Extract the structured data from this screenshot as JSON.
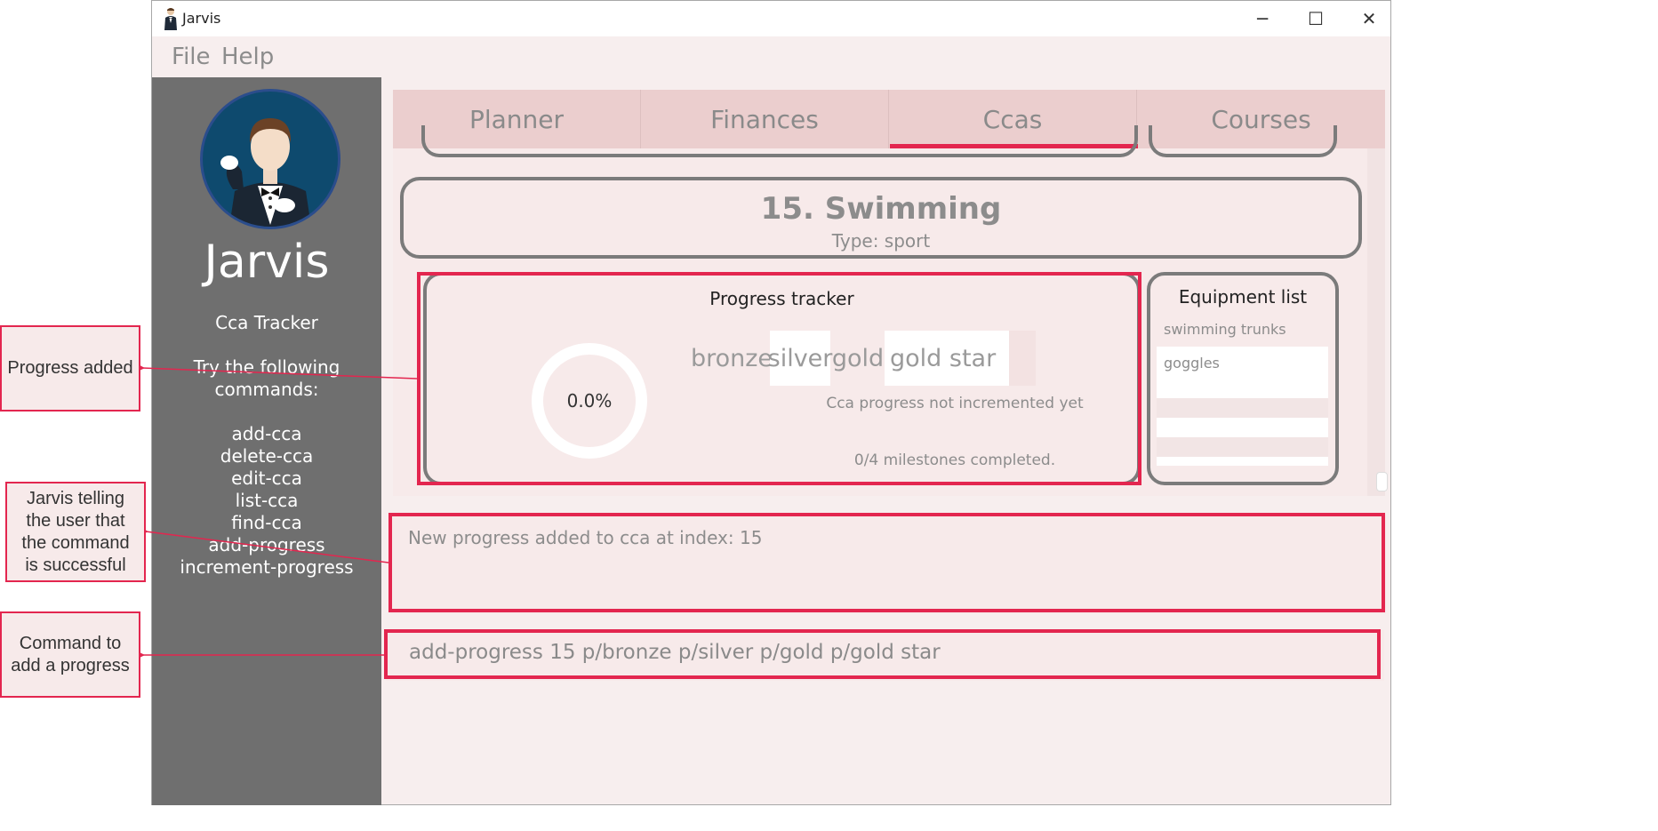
{
  "window": {
    "title": "Jarvis",
    "controls": {
      "minimize": "─",
      "maximize": "☐",
      "close": "✕"
    }
  },
  "menu": {
    "items": [
      "File",
      "Help"
    ]
  },
  "sidebar": {
    "title": "Jarvis",
    "subtitle": "Cca Tracker",
    "prompt_line1": "Try the following",
    "prompt_line2": "commands:",
    "commands": [
      "add-cca",
      "delete-cca",
      "edit-cca",
      "list-cca",
      "find-cca",
      "add-progress",
      "increment-progress"
    ]
  },
  "tabs": {
    "items": [
      "Planner",
      "Finances",
      "Ccas",
      "Courses"
    ],
    "active": "Ccas"
  },
  "cca": {
    "name_line": "15.  Swimming",
    "type_line": "Type: sport"
  },
  "progress": {
    "title": "Progress tracker",
    "percent_label": "0.0%",
    "percent_value": 0,
    "milestones": [
      "bronze",
      "silver",
      "gold",
      "gold star"
    ],
    "status": "Cca progress not incremented yet",
    "completed_text": "0/4 milestones completed."
  },
  "equipment": {
    "title": "Equipment list",
    "items": [
      "swimming trunks",
      "goggles"
    ]
  },
  "result": {
    "text": "New progress added to cca at index: 15"
  },
  "command": {
    "text": "add-progress 15 p/bronze p/silver p/gold p/gold star"
  },
  "annotations": {
    "progress_added": "Progress added",
    "jarvis_telling": [
      "Jarvis telling",
      "the user that",
      "the command",
      "is successful"
    ],
    "command_to_add": [
      "Command to",
      "add a progress"
    ]
  },
  "colors": {
    "accent": "#e3264f",
    "sidebar": "#6f6f6f",
    "tab_bar": "#ebcece",
    "panel_bg": "#f7eaea",
    "card_border": "#7b7b7b"
  }
}
